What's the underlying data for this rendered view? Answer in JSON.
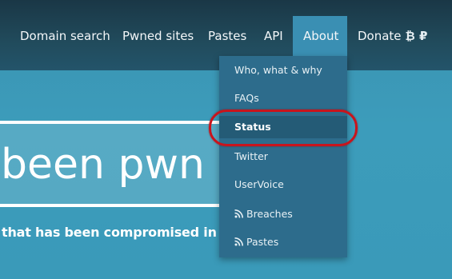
{
  "nav": {
    "items": [
      {
        "label": "Domain search"
      },
      {
        "label": "Pwned sites"
      },
      {
        "label": "Pastes"
      },
      {
        "label": "API"
      },
      {
        "label": "About"
      },
      {
        "label": "Donate"
      }
    ],
    "donate_coins": "₿ ₽",
    "active_item": "About"
  },
  "hero": {
    "title": "been pwn",
    "subtitle": "that has been compromised in a"
  },
  "about_menu": {
    "items": [
      {
        "label": "Who, what & why",
        "icon": ""
      },
      {
        "label": "FAQs",
        "icon": ""
      },
      {
        "label": "Status",
        "icon": "",
        "highlighted": true
      },
      {
        "label": "Twitter",
        "icon": ""
      },
      {
        "label": "UserVoice",
        "icon": ""
      },
      {
        "label": "Breaches",
        "icon": "rss-icon"
      },
      {
        "label": "Pastes",
        "icon": "rss-icon"
      }
    ]
  },
  "colors": {
    "navbar": "#1a3746",
    "background": "#3a92b0",
    "dropdown": "#2d6c8c",
    "highlight": "#245b76",
    "annotation": "#c8141c"
  }
}
